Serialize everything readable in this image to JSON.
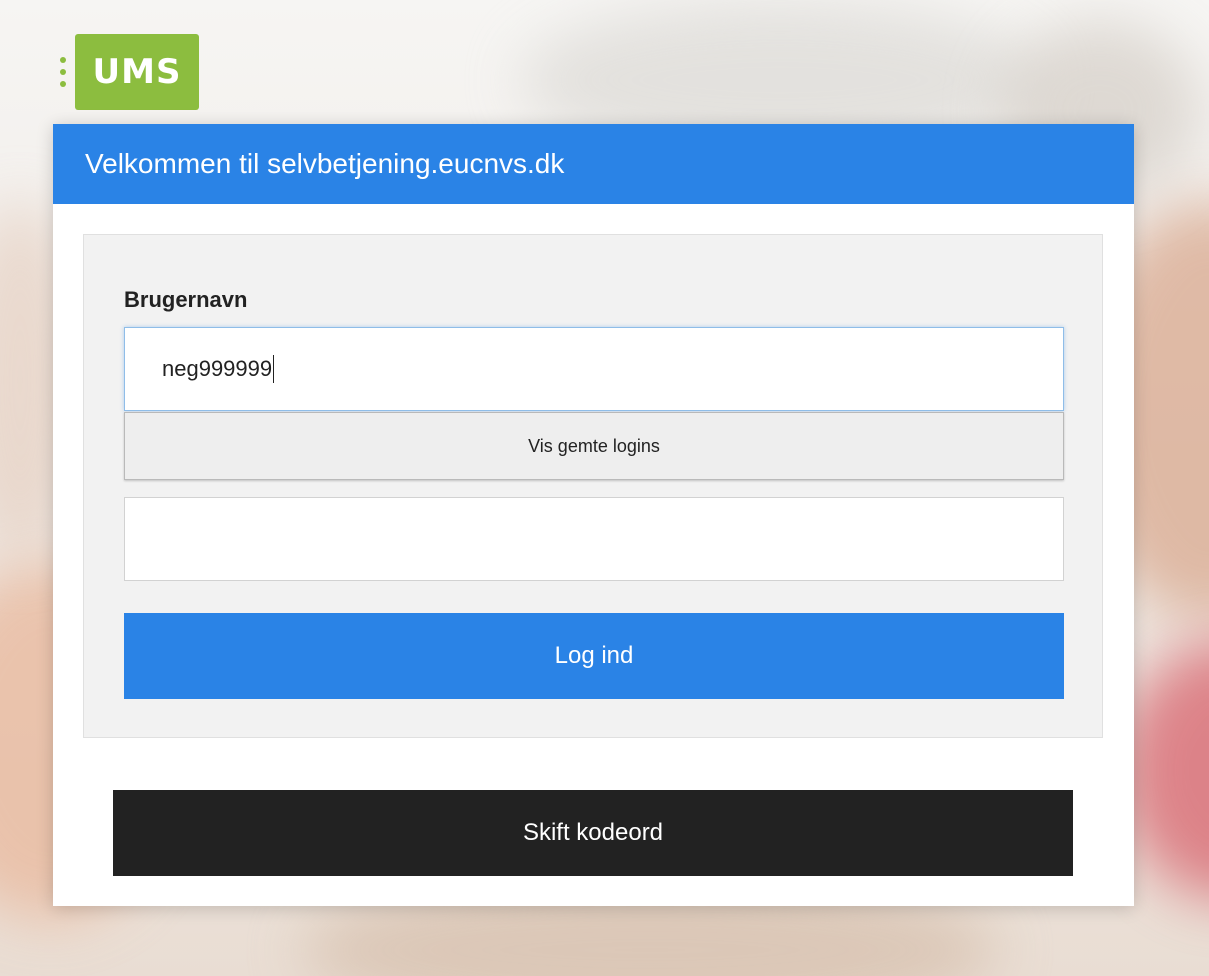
{
  "logo": {
    "text": "UMS",
    "brand_color": "#8cbd3f"
  },
  "card": {
    "title": "Velkommen til selvbetjening.eucnvs.dk",
    "header_color": "#2a83e6"
  },
  "form": {
    "username_label": "Brugernavn",
    "username_value": "neg999999",
    "saved_logins_label": "Vis gemte logins",
    "password_value": "",
    "login_label": "Log ind"
  },
  "footer": {
    "change_password_label": "Skift kodeord"
  }
}
